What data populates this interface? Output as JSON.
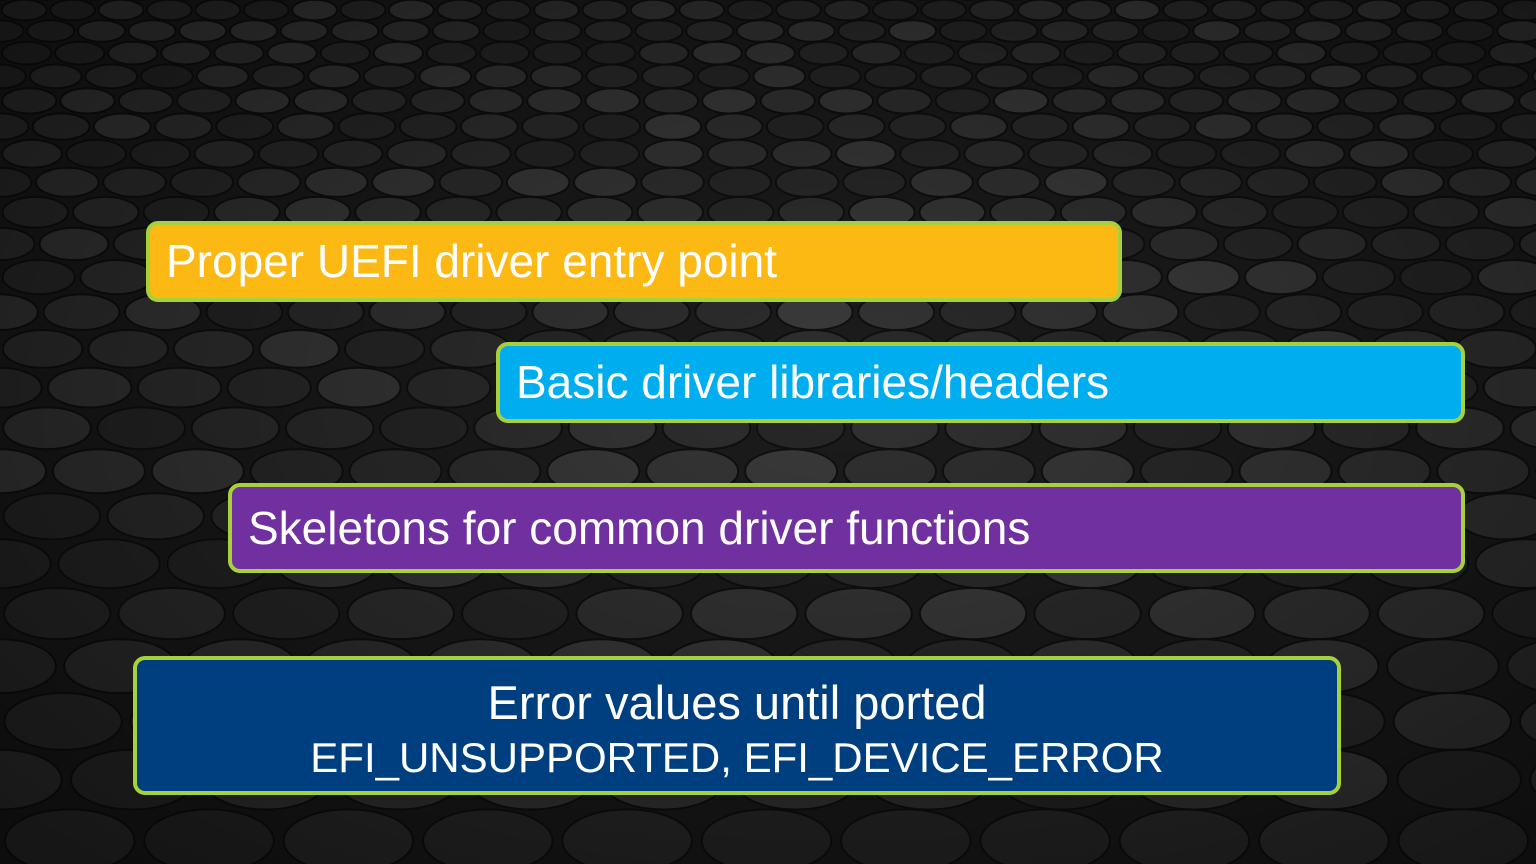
{
  "slide": {
    "items": [
      {
        "label": "Proper UEFI driver entry point",
        "color": "#fdb913"
      },
      {
        "label": "Basic driver libraries/headers",
        "color": "#00aeef"
      },
      {
        "label": "Skeletons for common driver functions",
        "color": "#7030a0"
      }
    ],
    "error_box": {
      "title": "Error values until ported",
      "values": "EFI_UNSUPPORTED, EFI_DEVICE_ERROR",
      "color": "#003f7f"
    },
    "border_color": "#a6d13c",
    "background": "dark hexagonal-pattern texture"
  }
}
